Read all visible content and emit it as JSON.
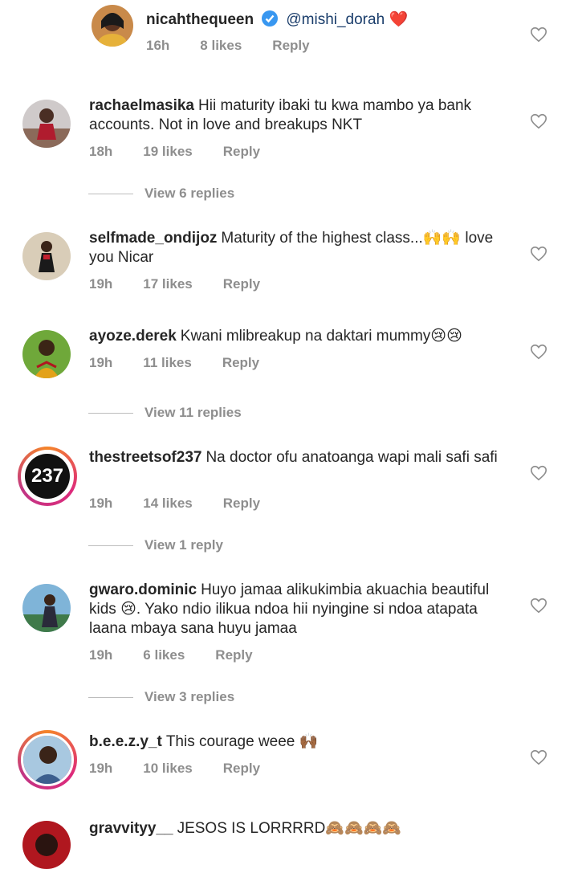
{
  "comments": [
    {
      "username": "nicahthequeen",
      "verified": true,
      "mention": "@mishi_dorah",
      "text": "❤️",
      "time": "16h",
      "likes": "8 likes",
      "reply": "Reply"
    },
    {
      "username": "rachaelmasika",
      "text": "Hii maturity ibaki tu kwa mambo ya bank accounts. Not in love and breakups NKT",
      "time": "18h",
      "likes": "19 likes",
      "reply": "Reply",
      "view_replies": "View 6 replies"
    },
    {
      "username": "selfmade_ondijoz",
      "text": "Maturity of the highest class...🙌🙌 love you Nicar",
      "time": "19h",
      "likes": "17 likes",
      "reply": "Reply"
    },
    {
      "username": "ayoze.derek",
      "text": "Kwani mlibreakup na daktari mummy😢😢",
      "time": "19h",
      "likes": "11 likes",
      "reply": "Reply",
      "view_replies": "View 11 replies"
    },
    {
      "username": "thestreetsof237",
      "avatar_text": "237",
      "text": "Na doctor ofu anatoanga wapi mali safi safi",
      "time": "19h",
      "likes": "14 likes",
      "reply": "Reply",
      "view_replies": "View 1 reply"
    },
    {
      "username": "gwaro.dominic",
      "text": "Huyo jamaa alikukimbia akuachia beautiful kids 😢. Yako ndio ilikua ndoa hii nyingine si ndoa atapata laana mbaya sana huyu jamaa",
      "time": "19h",
      "likes": "6 likes",
      "reply": "Reply",
      "view_replies": "View 3 replies"
    },
    {
      "username": "b.e.e.z.y_t",
      "text": "This courage weee 🙌🏾",
      "time": "19h",
      "likes": "10 likes",
      "reply": "Reply"
    },
    {
      "username": "gravvityy__",
      "text": "JESOS IS LORRRRD🙈🙈🙈🙈"
    }
  ],
  "colors": {
    "text": "#262626",
    "meta": "#8e8e8e",
    "mention": "#1a3d6b",
    "verified": "#3897f0",
    "heart_outline": "#8e8e8e"
  }
}
